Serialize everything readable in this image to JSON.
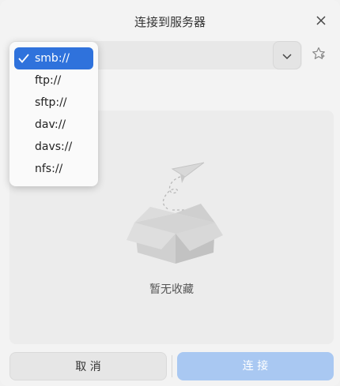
{
  "dialog": {
    "title": "连接到服务器",
    "close_icon": "close-icon"
  },
  "address": {
    "value": "",
    "history_icon": "chevron-down-icon",
    "favorite_icon": "star-icon"
  },
  "protocols": {
    "selected": "smb://",
    "options": [
      "smb://",
      "ftp://",
      "sftp://",
      "dav://",
      "davs://",
      "nfs://"
    ]
  },
  "favorites": {
    "empty_text": "暂无收藏",
    "illustration": "empty-box-with-paper-plane"
  },
  "footer": {
    "cancel_label": "取 消",
    "connect_label": "连 接"
  },
  "colors": {
    "accent": "#2f72dc",
    "connect_disabled": "#a9c8f2"
  }
}
